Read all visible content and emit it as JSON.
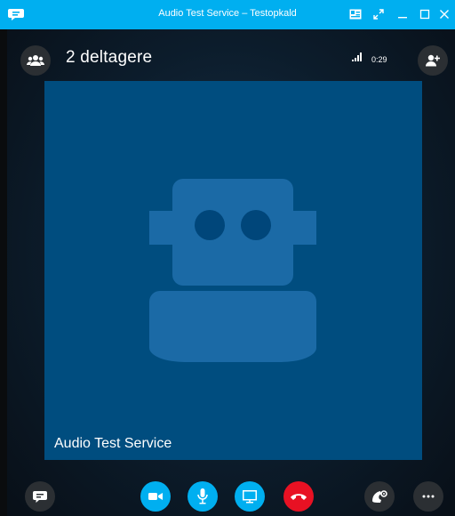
{
  "window": {
    "title": "Audio Test Service – Testopkald"
  },
  "call": {
    "participants_label": "2 deltagere",
    "duration": "0:29",
    "signal_bars": 4,
    "tile_name": "Audio Test Service"
  },
  "colors": {
    "accent": "#00aff0",
    "end_call": "#e81123",
    "tile": "#004d7f",
    "avatar": "#1b6aa6"
  },
  "icons": {
    "app": "skype-chat-icon",
    "participants": "people-icon",
    "add_person": "add-person-icon",
    "chat": "chat-icon",
    "video": "video-camera-icon",
    "mic": "microphone-icon",
    "share": "screen-share-icon",
    "hangup": "hang-up-icon",
    "dialpad": "phone-settings-icon",
    "more": "more-icon"
  }
}
